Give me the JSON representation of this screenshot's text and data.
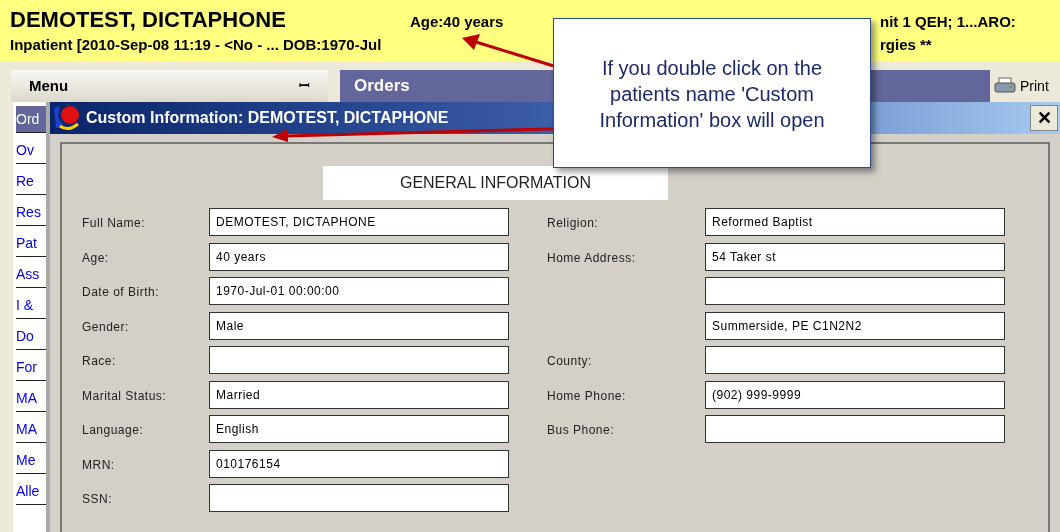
{
  "header": {
    "patient_name": "DEMOTEST, DICTAPHONE",
    "age": "Age:40 years",
    "location": "nit 1 QEH; 1...ARO:",
    "encounter": "Inpatient [2010-Sep-08 11:19 - <No - ... DOB:1970-Jul",
    "allergies": "rgies **"
  },
  "menu": {
    "title": "Menu",
    "pin": "ꟷ"
  },
  "orders_tab": {
    "label": "Orders"
  },
  "print_button": {
    "label": "Print"
  },
  "sidebar": {
    "items": [
      {
        "label": "Ord",
        "selected": true
      },
      {
        "label": "Ov",
        "selected": false
      },
      {
        "label": "Re",
        "selected": false
      },
      {
        "label": "Res",
        "selected": false
      },
      {
        "label": "Pat",
        "selected": false
      },
      {
        "label": "Ass",
        "selected": false
      },
      {
        "label": "I &",
        "selected": false
      },
      {
        "label": "Do",
        "selected": false
      },
      {
        "label": "For",
        "selected": false
      },
      {
        "label": "MA",
        "selected": false
      },
      {
        "label": "MA",
        "selected": false
      },
      {
        "label": "Me",
        "selected": false
      },
      {
        "label": "Alle",
        "selected": false
      }
    ]
  },
  "dialog": {
    "title": "Custom Information: DEMOTEST, DICTAPHONE",
    "close": "✕",
    "section_title": "GENERAL INFORMATION",
    "left_fields": [
      {
        "label": "Full Name:",
        "value": "DEMOTEST, DICTAPHONE"
      },
      {
        "label": "Age:",
        "value": "40 years"
      },
      {
        "label": "Date of Birth:",
        "value": "1970-Jul-01 00:00:00"
      },
      {
        "label": "Gender:",
        "value": "Male"
      },
      {
        "label": "Race:"
      },
      {
        "label": "Marital Status:",
        "value": "Married"
      },
      {
        "label": "Language:",
        "value": "English"
      },
      {
        "label": "MRN:",
        "value": "010176154"
      },
      {
        "label": "SSN:"
      }
    ],
    "right_fields": [
      {
        "kind": "field",
        "label": "Religion:",
        "value": "Reformed Baptist"
      },
      {
        "kind": "field",
        "label": "Home Address:",
        "value": "54 Taker st"
      },
      {
        "kind": "blank"
      },
      {
        "kind": "field",
        "value": "Summerside, PE C1N2N2"
      },
      {
        "kind": "field",
        "label": "County:"
      },
      {
        "kind": "field",
        "label": "Home Phone:",
        "value": "(902) 999-9999"
      },
      {
        "kind": "field",
        "label": "Bus Phone:"
      }
    ]
  },
  "callout": {
    "text": "If you double click on the patients name 'Custom Information' box will open"
  }
}
